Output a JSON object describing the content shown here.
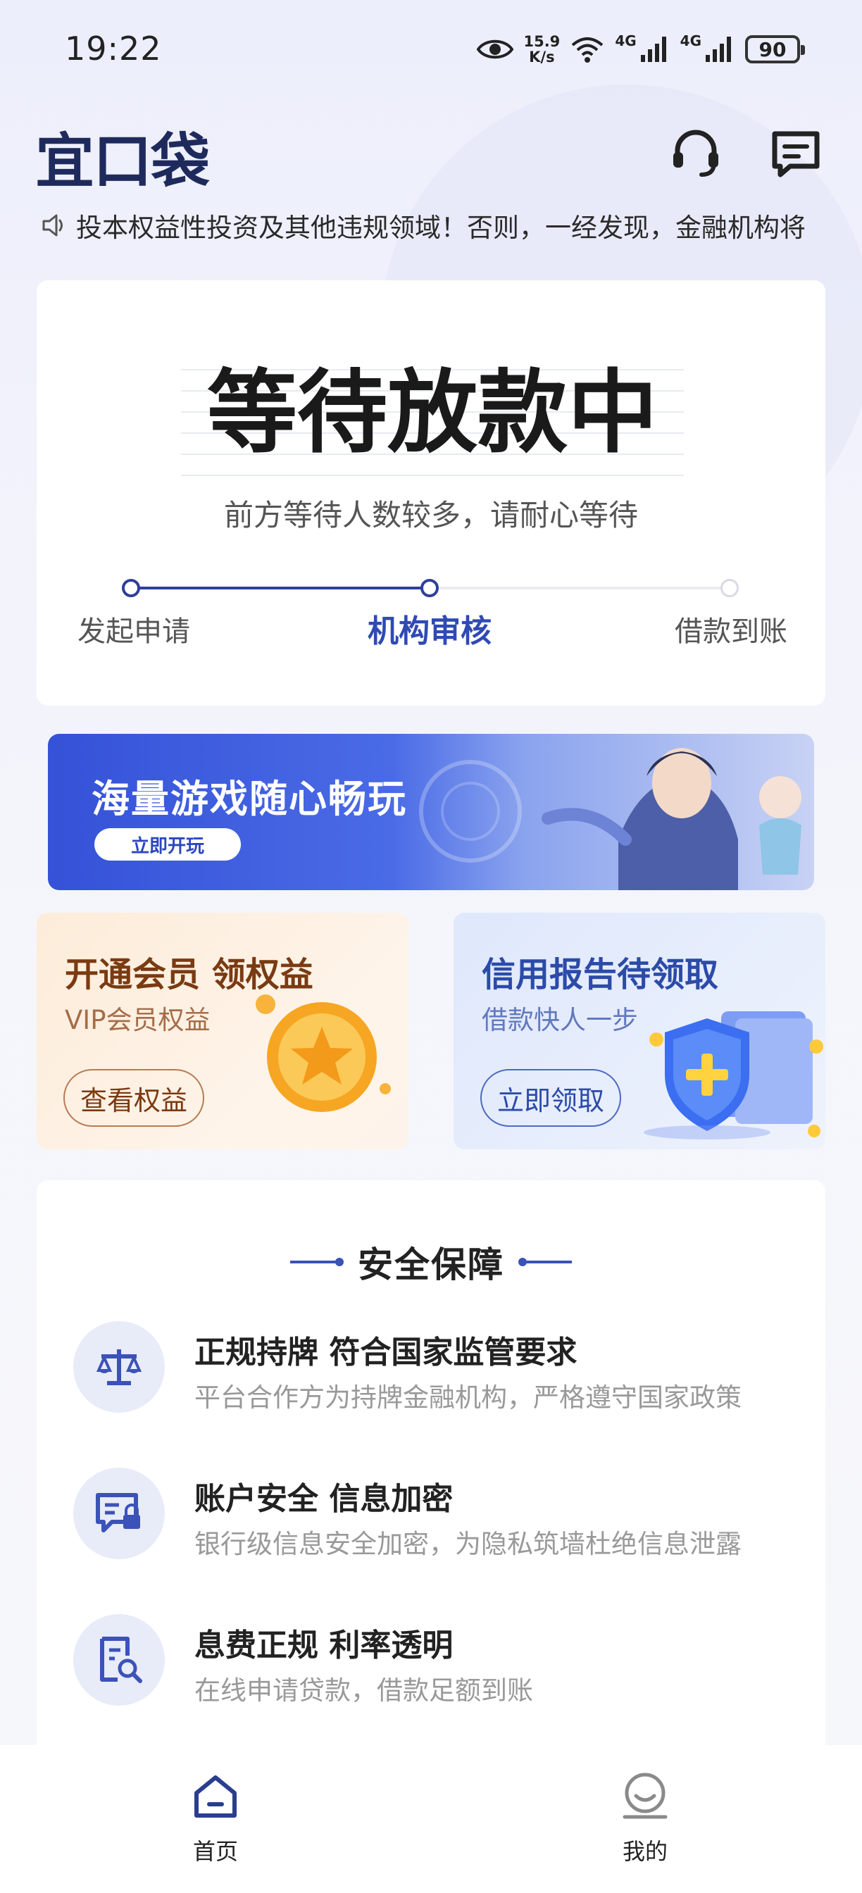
{
  "status_bar": {
    "time": "19:22",
    "net_speed_value": "15.9",
    "net_speed_unit": "K/s",
    "sim1_label": "4G",
    "sim2_label": "4G",
    "battery": "90"
  },
  "header": {
    "app_name": "宜口袋"
  },
  "notice": {
    "text": "投本权益性投资及其他违规领域！否则，一经发现，金融机构将"
  },
  "loan_status": {
    "title": "等待放款中",
    "subtitle": "前方等待人数较多，请耐心等待",
    "steps": [
      {
        "label": "发起申请"
      },
      {
        "label": "机构审核"
      },
      {
        "label": "借款到账"
      }
    ]
  },
  "game_banner": {
    "title": "海量游戏随心畅玩",
    "button_label": "立即开玩"
  },
  "promos": {
    "vip": {
      "title": "开通会员 领权益",
      "subtitle": "VIP会员权益",
      "button_label": "查看权益"
    },
    "credit": {
      "title": "信用报告待领取",
      "subtitle": "借款快人一步",
      "button_label": "立即领取"
    }
  },
  "security": {
    "title": "安全保障",
    "items": [
      {
        "title": "正规持牌 符合国家监管要求",
        "desc": "平台合作方为持牌金融机构，严格遵守国家政策"
      },
      {
        "title": "账户安全 信息加密",
        "desc": "银行级信息安全加密，为隐私筑墙杜绝信息泄露"
      },
      {
        "title": "息费正规  利率透明",
        "desc": "在线申请贷款，借款足额到账"
      }
    ]
  },
  "bottom_nav": {
    "items": [
      {
        "label": "首页"
      },
      {
        "label": "我的"
      }
    ]
  },
  "colors": {
    "brand": "#2f3f9c",
    "accent_blue": "#2f4ab4",
    "vip_brown": "#7a3a12"
  }
}
